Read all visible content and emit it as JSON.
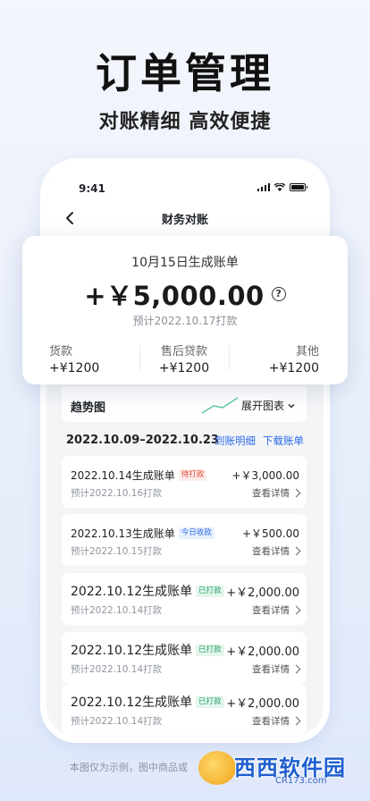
{
  "headline": "订单管理",
  "subline": "对账精细 高效便捷",
  "status": {
    "time": "9:41"
  },
  "nav": {
    "title": "财务对账"
  },
  "summary": {
    "title": "10月15日生成账单",
    "amount": "+￥5,000.00",
    "help": "?",
    "pay_date": "预计2022.10.17打款",
    "cols": [
      {
        "label": "货款",
        "value": "+¥1200"
      },
      {
        "label": "售后贷款",
        "value": "+¥1200"
      },
      {
        "label": "其他",
        "value": "+¥1200"
      }
    ]
  },
  "trend": {
    "label": "趋势图",
    "expand": "展开图表"
  },
  "range": {
    "text": "2022.10.09–2022.10.23",
    "detail": "到账明细",
    "download": "下载账单"
  },
  "bills": [
    {
      "title": "2022.10.14生成账单",
      "tag": "待打款",
      "amount": "+￥3,000.00",
      "date": "预计2022.10.16打款",
      "link": "查看详情"
    },
    {
      "title": "2022.10.13生成账单",
      "tag": "今日收款",
      "amount": "+￥500.00",
      "date": "预计2022.10.15打款",
      "link": "查看详情"
    },
    {
      "title": "2022.10.12生成账单",
      "tag": "已打款",
      "amount": "+￥2,000.00",
      "date": "预计2022.10.14打款",
      "link": "查看详情"
    },
    {
      "title": "2022.10.12生成账单",
      "tag": "已打款",
      "amount": "+￥2,000.00",
      "date": "预计2022.10.14打款",
      "link": "查看详情"
    },
    {
      "title": "2022.10.12生成账单",
      "tag": "已打款",
      "amount": "+￥2,000.00",
      "date": "预计2022.10.14打款",
      "link": "查看详情"
    }
  ],
  "footer_note": "本图仅为示例，图中商品或",
  "watermark": {
    "text": "西西软件园",
    "url": "CR173.com"
  },
  "colors": {
    "accent": "#2e6bea",
    "pending": "#e0473d",
    "paid": "#27a36a"
  }
}
